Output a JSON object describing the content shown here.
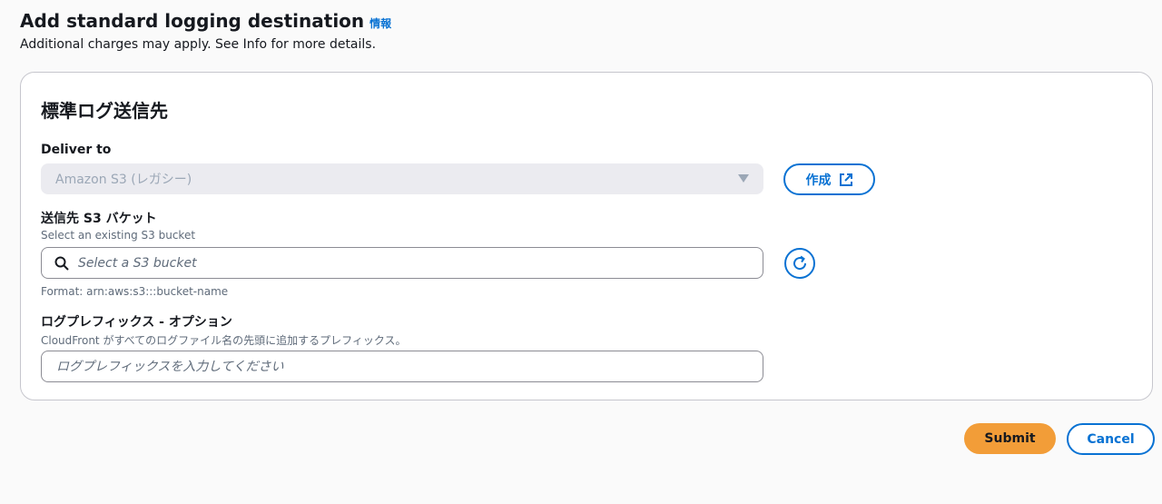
{
  "header": {
    "title": "Add standard logging destination",
    "info_link": "情報",
    "description": "Additional charges may apply. See Info for more details."
  },
  "panel": {
    "title": "標準ログ送信先",
    "deliver_to": {
      "label": "Deliver to",
      "selected_value": "Amazon S3 (レガシー)",
      "disabled": true,
      "create_label": "作成"
    },
    "bucket": {
      "label": "送信先 S3 バケット",
      "description": "Select an existing S3 bucket",
      "placeholder": "Select a S3 bucket",
      "value": "",
      "format_hint": "Format: arn:aws:s3:::bucket-name"
    },
    "prefix": {
      "label": "ログプレフィックス - オプション",
      "description": "CloudFront がすべてのログファイル名の先頭に追加するプレフィックス。",
      "placeholder": "ログプレフィックスを入力してください",
      "value": ""
    }
  },
  "actions": {
    "submit_label": "Submit",
    "cancel_label": "Cancel"
  },
  "icons": {
    "caret": "caret-down-icon",
    "external": "external-link-icon",
    "search": "search-icon",
    "refresh": "refresh-icon"
  },
  "colors": {
    "primary": "#0972d3",
    "submit": "#f29d38",
    "text": "#16191f",
    "muted": "#5f6b7a",
    "disabled_bg": "#ebebf0",
    "disabled_text": "#9ba7b6",
    "border": "#c6c6cd",
    "input_border": "#8c8c94"
  }
}
